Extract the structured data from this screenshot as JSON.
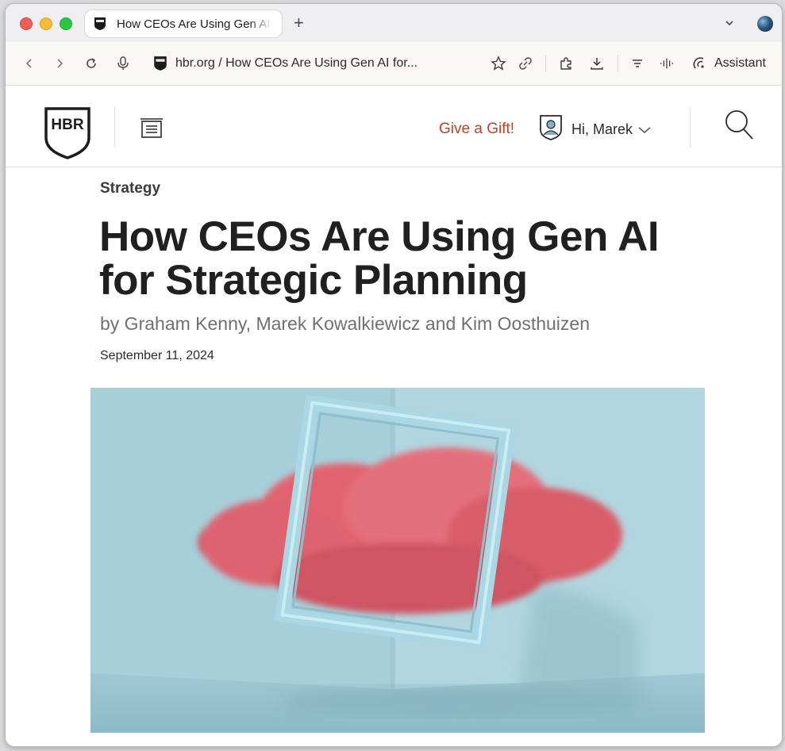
{
  "browser": {
    "tab": {
      "title": "How CEOs Are Using Gen AI for Strategic Planning"
    },
    "new_tab": "+",
    "address": "hbr.org / How CEOs Are Using Gen AI for...",
    "assistant_label": "Assistant"
  },
  "site": {
    "logo_text": "HBR",
    "gift_label": "Give a Gift!",
    "greeting": "Hi, Marek"
  },
  "article": {
    "section": "Strategy",
    "headline": "How CEOs Are Using Gen AI for Strategic Planning",
    "byline": "by Graham Kenny, Marek Kowalkiewicz and Kim Oosthuizen",
    "date": "September 11, 2024"
  },
  "colors": {
    "gift": "#c5401e",
    "hero_background": "#a9cfd9",
    "cloud": "#e0606a"
  }
}
